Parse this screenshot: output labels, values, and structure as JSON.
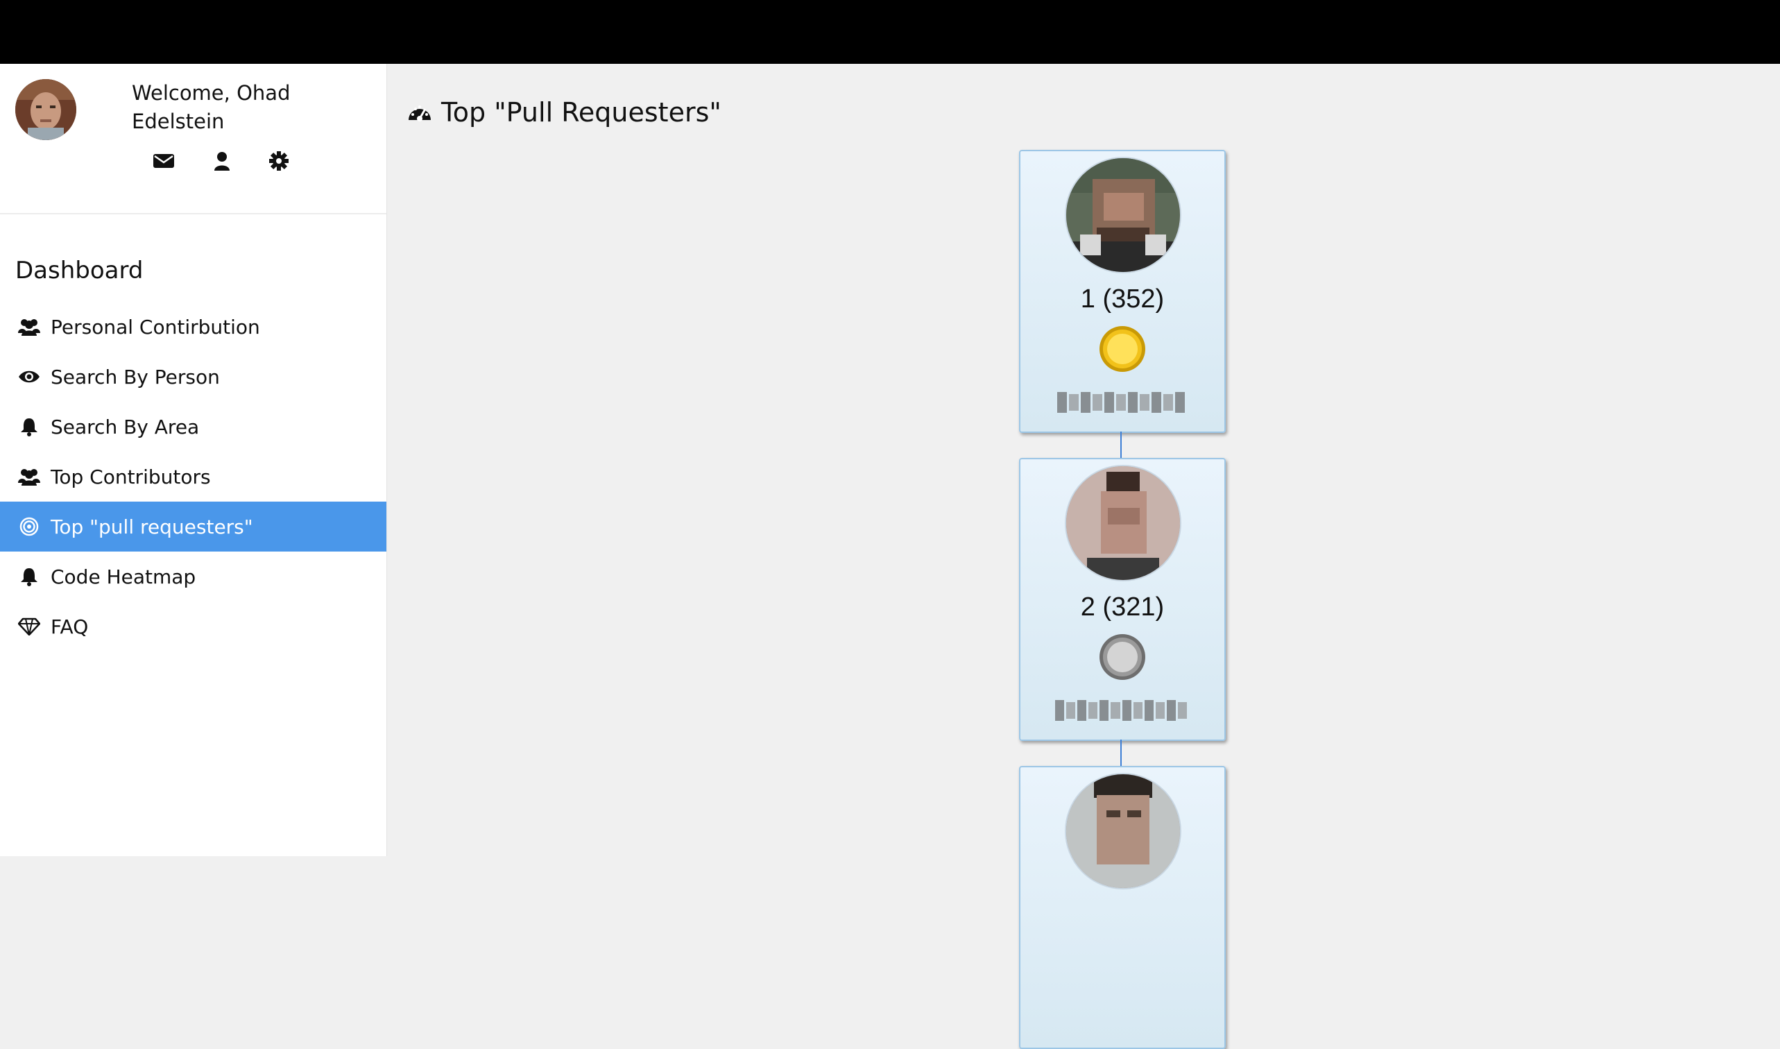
{
  "profile": {
    "welcome_prefix": "Welcome,",
    "user_name": "Ohad Edelstein"
  },
  "sidebar": {
    "menu_title": "Dashboard",
    "items": [
      {
        "label": "Personal Contirbution",
        "icon": "users-icon"
      },
      {
        "label": "Search By Person",
        "icon": "eye-icon"
      },
      {
        "label": "Search By Area",
        "icon": "bell-icon"
      },
      {
        "label": "Top Contributors",
        "icon": "users-icon"
      },
      {
        "label": "Top \"pull requesters\"",
        "icon": "target-icon",
        "active": true
      },
      {
        "label": "Code Heatmap",
        "icon": "bell-icon"
      },
      {
        "label": "FAQ",
        "icon": "diamond-icon"
      }
    ]
  },
  "main": {
    "title": "Top \"Pull Requesters\"",
    "title_icon": "dashboard-icon"
  },
  "leaderboard": [
    {
      "rank_text": "1 (352)",
      "medal": "gold"
    },
    {
      "rank_text": "2 (321)",
      "medal": "silver"
    },
    {
      "rank_text": "",
      "medal": ""
    }
  ],
  "colors": {
    "accent": "#4a97ea",
    "card_border": "#9cc6e6",
    "connector": "#3d7fd6",
    "topbar": "#000000"
  }
}
